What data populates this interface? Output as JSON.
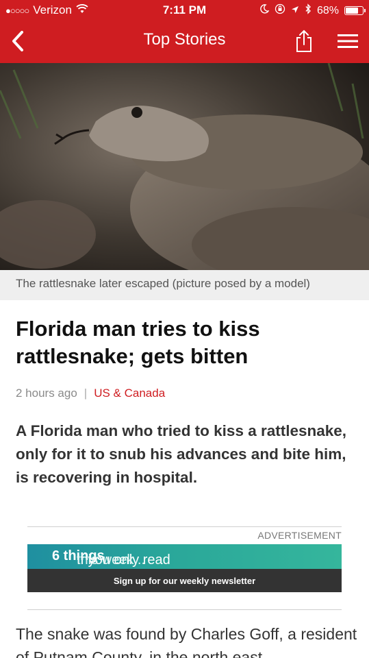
{
  "status_bar": {
    "carrier": "Verizon",
    "time": "7:11 PM",
    "battery": "68%",
    "battery_level": 0.68
  },
  "nav": {
    "title": "Top Stories"
  },
  "hero": {
    "caption": "The rattlesnake later escaped (picture posed by a model)"
  },
  "article": {
    "headline": "Florida man tries to kiss rattlesnake; gets bitten",
    "time_ago": "2 hours ago",
    "category": "US & Canada",
    "summary": "A Florida man who tried to kiss a rattlesnake, only for it to snub his advances and bite him, is recovering in hospital.",
    "body": "The snake was found by Charles Goff, a resident of Putnam County, in the north east"
  },
  "ad": {
    "label": "ADVERTISEMENT",
    "headline_prefix": "If you only read",
    "headline_bold": "6 things",
    "headline_suffix": "this week...",
    "cta": "Sign up for our weekly newsletter"
  }
}
